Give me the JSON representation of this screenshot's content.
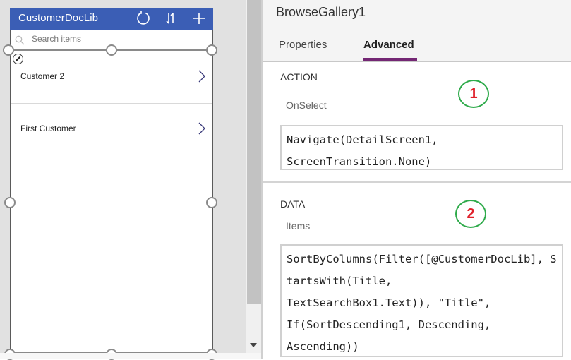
{
  "app": {
    "title": "CustomerDocLib",
    "header_icons": [
      "refresh-icon",
      "sort-icon",
      "add-icon"
    ],
    "search": {
      "placeholder": "Search items",
      "value": ""
    },
    "gallery_items": [
      {
        "label": "Customer 2"
      },
      {
        "label": "First Customer"
      }
    ]
  },
  "panel": {
    "title": "BrowseGallery1",
    "tabs": [
      {
        "label": "Properties",
        "active": false
      },
      {
        "label": "Advanced",
        "active": true
      }
    ],
    "sections": [
      {
        "title": "ACTION",
        "property": "OnSelect",
        "formula": "Navigate(DetailScreen1,\nScreenTransition.None)",
        "annotation": "1"
      },
      {
        "title": "DATA",
        "property": "Items",
        "formula": "SortByColumns(Filter([@CustomerDocLib], StartsWith(Title,\nTextSearchBox1.Text)), \"Title\",\nIf(SortDescending1, Descending,\nAscending))",
        "annotation": "2"
      }
    ]
  },
  "colors": {
    "header_bg": "#3b5eb5",
    "tab_accent": "#742774",
    "annotation_circle": "#2eaa4a",
    "annotation_number": "#e0202a"
  }
}
